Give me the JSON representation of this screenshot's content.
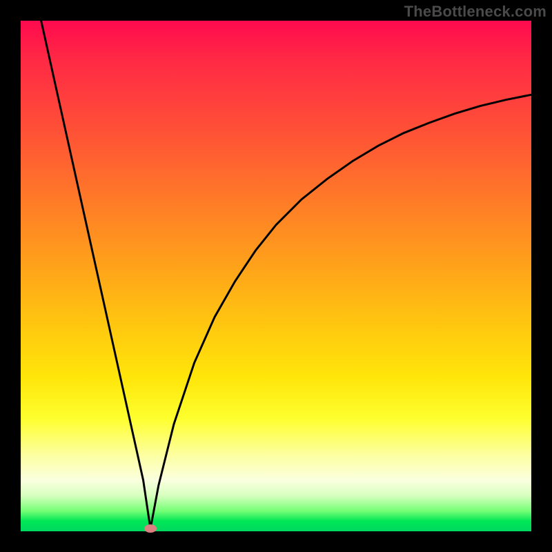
{
  "watermark": "TheBottleneck.com",
  "chart_data": {
    "type": "line",
    "title": "",
    "xlabel": "",
    "ylabel": "",
    "xlim": [
      0,
      100
    ],
    "ylim": [
      0,
      100
    ],
    "grid": false,
    "legend": false,
    "series": [
      {
        "name": "curve",
        "x": [
          4,
          6,
          8,
          10,
          12,
          14,
          16,
          18,
          20,
          22,
          24,
          25.4,
          27,
          30,
          34,
          38,
          42,
          46,
          50,
          55,
          60,
          65,
          70,
          75,
          80,
          85,
          90,
          95,
          100
        ],
        "values": [
          100,
          91,
          82,
          73,
          64,
          55,
          46,
          37,
          28,
          19,
          10,
          0.5,
          9,
          21,
          33,
          42,
          49,
          55,
          60,
          65,
          69,
          72.5,
          75.5,
          78,
          80,
          81.8,
          83.3,
          84.5,
          85.5
        ]
      }
    ],
    "marker": {
      "x": 25.4,
      "y": 0.5
    }
  },
  "colors": {
    "curve": "#000000",
    "marker": "#d98080",
    "frame": "#000000"
  }
}
